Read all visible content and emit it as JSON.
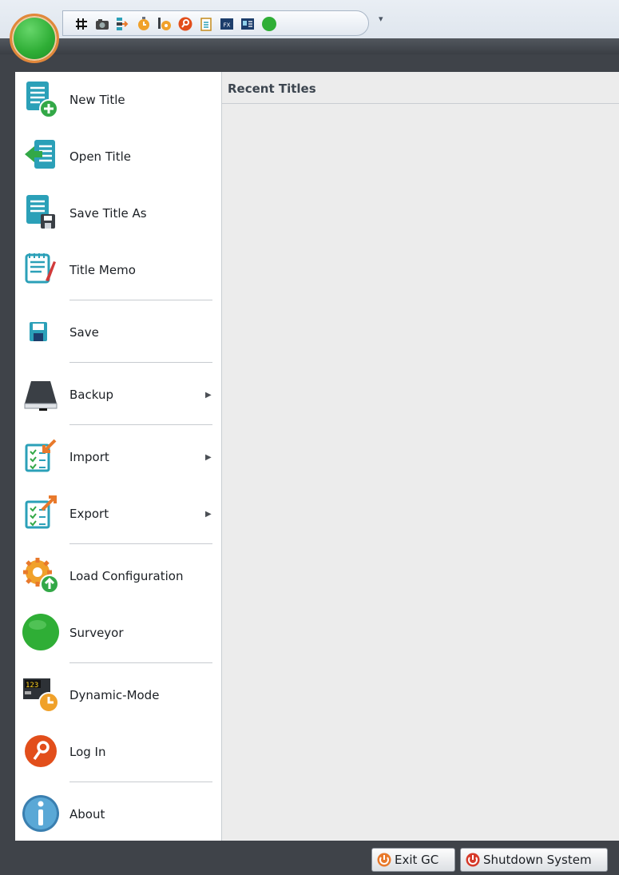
{
  "app_menu": {
    "items": [
      {
        "label": "New Title",
        "icon": "new-title-icon",
        "submenu": false
      },
      {
        "label": "Open Title",
        "icon": "open-title-icon",
        "submenu": false
      },
      {
        "label": "Save Title As",
        "icon": "save-title-as-icon",
        "submenu": false
      },
      {
        "label": "Title Memo",
        "icon": "title-memo-icon",
        "submenu": false
      },
      {
        "label": "Save",
        "icon": "save-icon",
        "submenu": false
      },
      {
        "label": "Backup",
        "icon": "backup-drive-icon",
        "submenu": true
      },
      {
        "label": "Import",
        "icon": "import-icon",
        "submenu": true
      },
      {
        "label": "Export",
        "icon": "export-icon",
        "submenu": true
      },
      {
        "label": "Load Configuration",
        "icon": "load-configuration-icon",
        "submenu": false
      },
      {
        "label": "Surveyor",
        "icon": "surveyor-icon",
        "submenu": false
      },
      {
        "label": "Dynamic-Mode",
        "icon": "dynamic-mode-icon",
        "submenu": false
      },
      {
        "label": "Log In",
        "icon": "login-key-icon",
        "submenu": false
      },
      {
        "label": "About",
        "icon": "about-info-icon",
        "submenu": false
      }
    ],
    "submenu_arrow": "▶"
  },
  "recent": {
    "title": "Recent Titles"
  },
  "footer": {
    "exit_label": "Exit GC",
    "shutdown_label": "Shutdown System"
  },
  "quick_access": {
    "icons": [
      "grid-icon",
      "camera-icon",
      "flow-icon",
      "timer-icon",
      "timer-settings-icon",
      "key-icon",
      "clipboard-icon",
      "fx-icon",
      "card-icon",
      "green-dot-icon"
    ],
    "more": "▾"
  },
  "colors": {
    "orb_green": "#2fae36",
    "orb_ring": "#e2873a",
    "frame_dark": "#3f4349",
    "accent_orange": "#e8792b",
    "accent_teal": "#2ba0b8"
  }
}
